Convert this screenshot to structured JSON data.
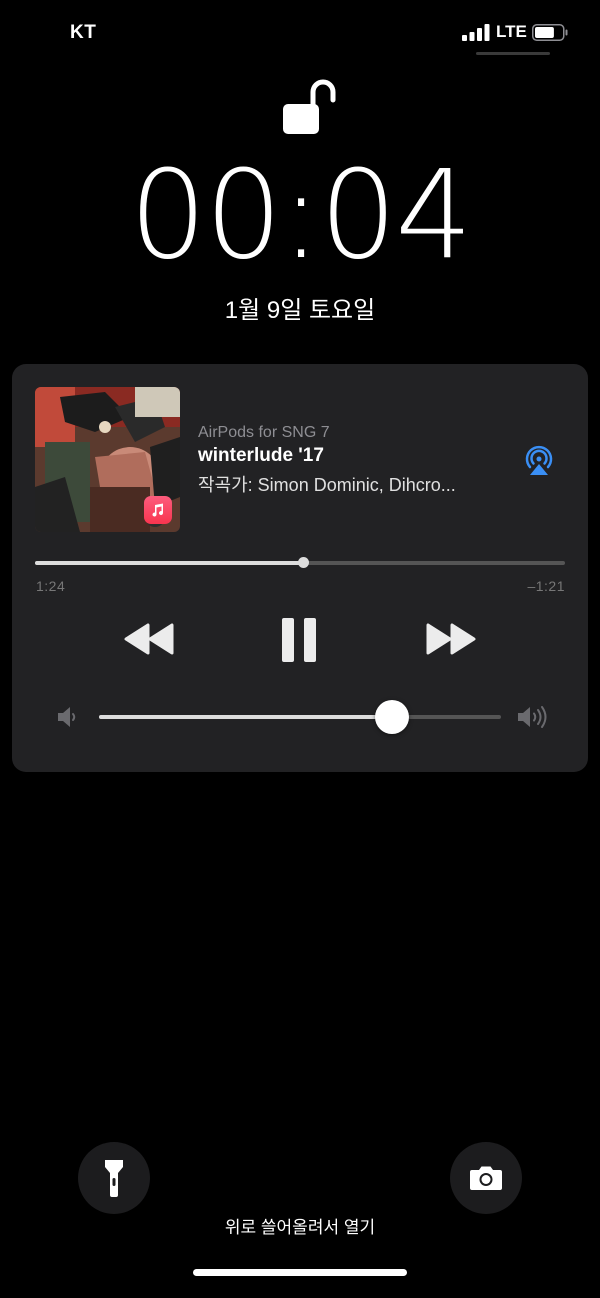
{
  "status_bar": {
    "carrier": "KT",
    "network": "LTE",
    "battery_level": 0.7
  },
  "lock_screen": {
    "time": "00:04",
    "date": "1월 9일 토요일"
  },
  "now_playing": {
    "source": "AirPods for SNG 7",
    "title": "winterlude '17",
    "artist": "작곡가: Simon Dominic, Dihcro...",
    "elapsed": "1:24",
    "remaining": "–1:21",
    "progress": 0.505,
    "volume": 0.73,
    "icons": {
      "album_art": "album-art-image",
      "music_app": "apple-music-icon",
      "airplay": "airplay-icon",
      "rewind": "rewind-icon",
      "pause": "pause-icon",
      "forward": "fast-forward-icon",
      "volume_min": "speaker-low-icon",
      "volume_max": "speaker-high-icon"
    }
  },
  "quick_actions": {
    "flashlight": "flashlight-icon",
    "camera": "camera-icon"
  },
  "hint": "위로 쓸어올려서 열기",
  "colors": {
    "background": "#000000",
    "card": "#222224",
    "accent": "#3a8ff5"
  }
}
